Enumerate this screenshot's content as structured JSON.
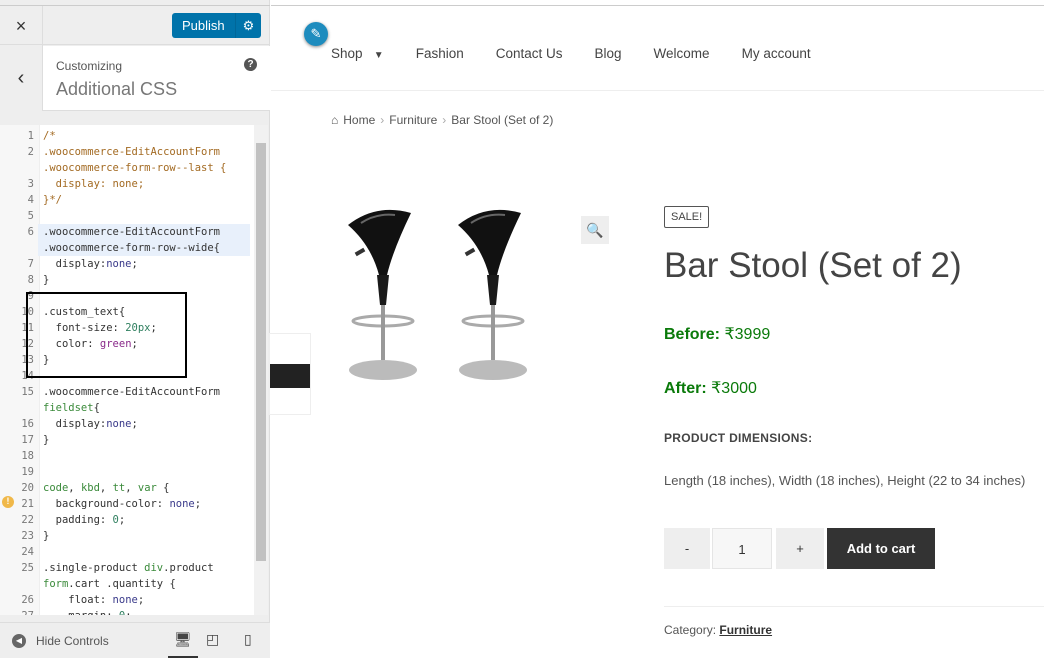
{
  "sidebar": {
    "close": "×",
    "publish": "Publish",
    "customizing": "Customizing",
    "title": "Additional CSS",
    "help": "?",
    "hide_controls": "Hide Controls",
    "code": [
      {
        "n": "1",
        "t": [
          [
            "/*",
            "c-com"
          ]
        ]
      },
      {
        "n": "2",
        "t": [
          [
            ".woocommerce-EditAccountForm",
            "c-com"
          ]
        ]
      },
      {
        "n": "",
        "t": [
          [
            ".woocommerce-form-row--last {",
            "c-com"
          ]
        ]
      },
      {
        "n": "3",
        "t": [
          [
            "  display: none;",
            "c-com"
          ]
        ]
      },
      {
        "n": "4",
        "t": [
          [
            "}*/",
            "c-com"
          ]
        ]
      },
      {
        "n": "5",
        "t": []
      },
      {
        "n": "6",
        "hl": true,
        "t": [
          [
            ".woocommerce-EditAccountForm",
            ""
          ]
        ]
      },
      {
        "n": "",
        "hl": true,
        "t": [
          [
            ".woocommerce-form-row--wide{",
            ""
          ]
        ]
      },
      {
        "n": "7",
        "t": [
          [
            "  display:",
            ""
          ],
          [
            "none",
            "c-kw"
          ],
          [
            ";",
            ""
          ]
        ]
      },
      {
        "n": "8",
        "t": [
          [
            "}",
            ""
          ]
        ]
      },
      {
        "n": "9",
        "t": []
      },
      {
        "n": "10",
        "t": [
          [
            ".custom_text{",
            ""
          ]
        ]
      },
      {
        "n": "11",
        "t": [
          [
            "  font-size: ",
            ""
          ],
          [
            "20px",
            "c-num"
          ],
          [
            ";",
            ""
          ]
        ]
      },
      {
        "n": "12",
        "t": [
          [
            "  color: ",
            ""
          ],
          [
            "green",
            "c-str"
          ],
          [
            ";",
            ""
          ]
        ]
      },
      {
        "n": "13",
        "t": [
          [
            "}",
            ""
          ]
        ]
      },
      {
        "n": "14",
        "t": []
      },
      {
        "n": "15",
        "t": [
          [
            ".woocommerce-EditAccountForm",
            ""
          ]
        ]
      },
      {
        "n": "",
        "t": [
          [
            "fieldset",
            "c-tag"
          ],
          [
            "{",
            ""
          ]
        ]
      },
      {
        "n": "16",
        "t": [
          [
            "  display:",
            ""
          ],
          [
            "none",
            "c-kw"
          ],
          [
            ";",
            ""
          ]
        ]
      },
      {
        "n": "17",
        "t": [
          [
            "}",
            ""
          ]
        ]
      },
      {
        "n": "18",
        "t": []
      },
      {
        "n": "19",
        "t": []
      },
      {
        "n": "20",
        "t": [
          [
            "code",
            "c-tag"
          ],
          [
            ", ",
            ""
          ],
          [
            "kbd",
            "c-tag"
          ],
          [
            ", ",
            ""
          ],
          [
            "tt",
            "c-tag"
          ],
          [
            ", ",
            ""
          ],
          [
            "var",
            "c-tag"
          ],
          [
            " {",
            ""
          ]
        ]
      },
      {
        "n": "21",
        "warn": true,
        "t": [
          [
            "  background-color: ",
            ""
          ],
          [
            "none",
            "c-kw"
          ],
          [
            ";",
            ""
          ]
        ]
      },
      {
        "n": "22",
        "t": [
          [
            "  padding: ",
            ""
          ],
          [
            "0",
            "c-num"
          ],
          [
            ";",
            ""
          ]
        ]
      },
      {
        "n": "23",
        "t": [
          [
            "}",
            ""
          ]
        ]
      },
      {
        "n": "24",
        "t": []
      },
      {
        "n": "25",
        "t": [
          [
            ".single-product ",
            ""
          ],
          [
            "div",
            "c-tag"
          ],
          [
            ".product",
            ""
          ]
        ]
      },
      {
        "n": "",
        "t": [
          [
            "form",
            "c-tag"
          ],
          [
            ".cart .quantity {",
            ""
          ]
        ]
      },
      {
        "n": "26",
        "t": [
          [
            "    float: ",
            ""
          ],
          [
            "none",
            "c-kw"
          ],
          [
            ";",
            ""
          ]
        ]
      },
      {
        "n": "27",
        "t": [
          [
            "    margin: ",
            ""
          ],
          [
            "0",
            "c-num"
          ],
          [
            ";",
            ""
          ]
        ]
      }
    ]
  },
  "nav": {
    "items": [
      "Shop",
      "Fashion",
      "Contact Us",
      "Blog",
      "Welcome",
      "My account"
    ]
  },
  "breadcrumb": [
    "Home",
    "Furniture",
    "Bar Stool (Set of 2)"
  ],
  "product": {
    "sale": "SALE!",
    "title": "Bar Stool (Set of 2)",
    "before_label": "Before:",
    "before_value": "₹3999",
    "after_label": "After:",
    "after_value": "₹3000",
    "dim_label": "PRODUCT DIMENSIONS:",
    "dim_value": "Length (18 inches), Width (18 inches), Height (22 to 34 inches)",
    "minus": "-",
    "qty": "1",
    "plus": "+",
    "add_to_cart": "Add to cart",
    "category_label": "Category:",
    "category": "Furniture"
  },
  "colors": {
    "accent": "#0073aa",
    "price": "#0a7a0a"
  }
}
